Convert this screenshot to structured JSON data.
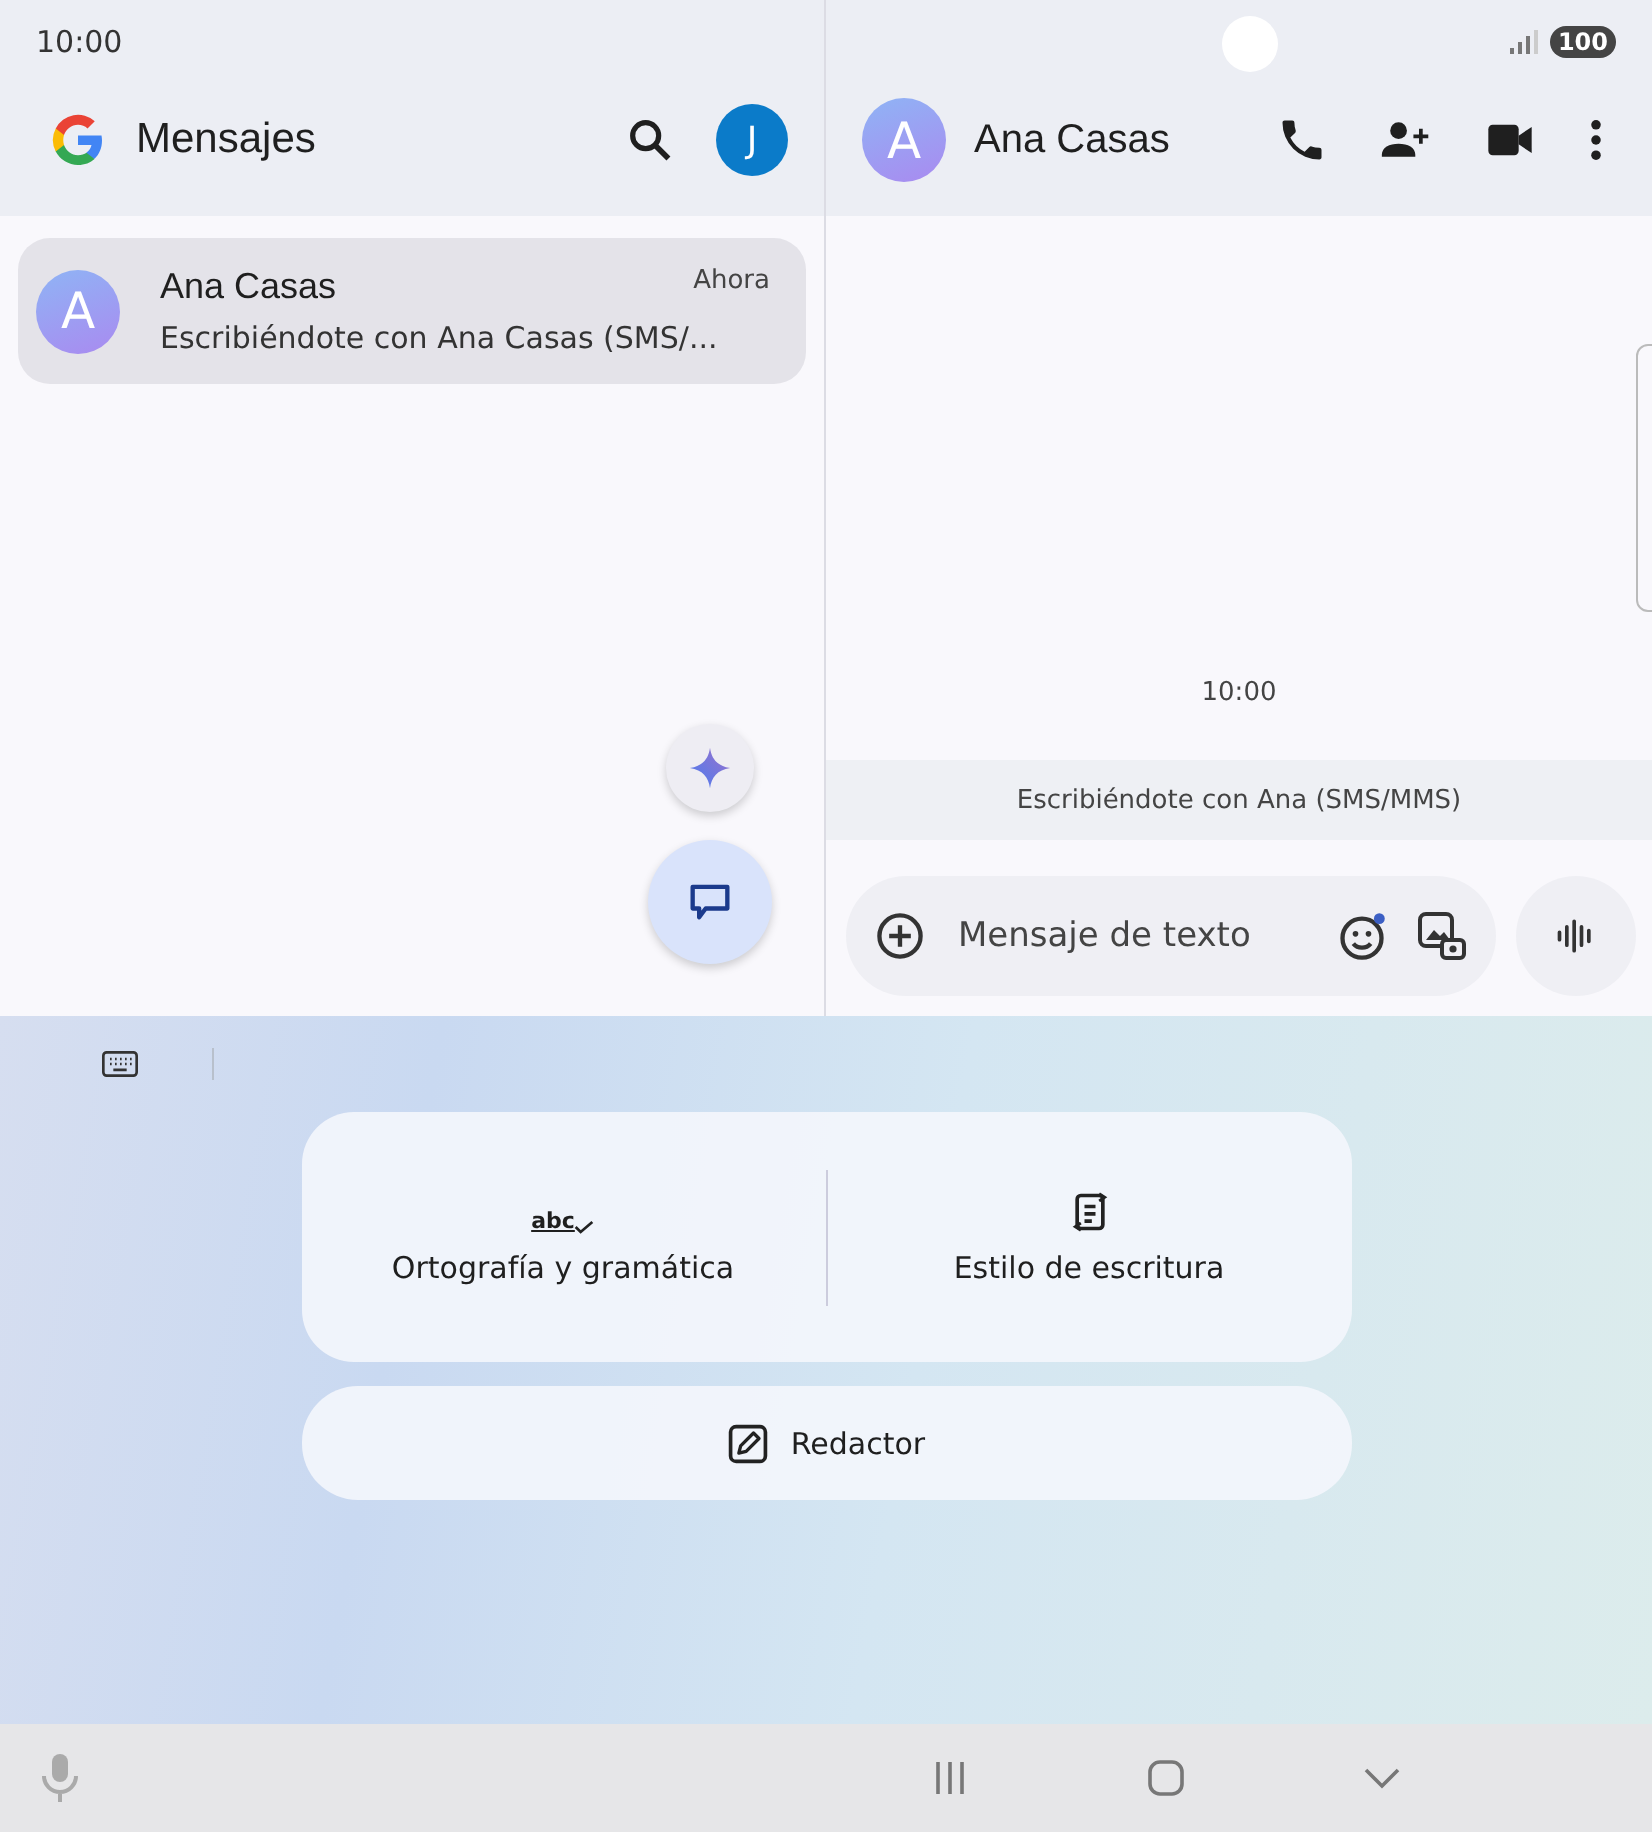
{
  "status_bar": {
    "time": "10:00",
    "battery": "100"
  },
  "list_pane": {
    "title": "Mensajes",
    "account_initial": "J",
    "conversations": [
      {
        "initial": "A",
        "name": "Ana Casas",
        "time": "Ahora",
        "snippet": "Escribiéndote con Ana Casas (SMS/...",
        "selected": true
      }
    ]
  },
  "chat_pane": {
    "contact_initial": "A",
    "contact_name": "Ana Casas",
    "timestamp": "10:00",
    "banner": "Escribiéndote con Ana (SMS/MMS)",
    "composer": {
      "placeholder": "Mensaje de texto"
    }
  },
  "writing_tools": {
    "options": [
      {
        "kind": "spelling",
        "icon_text": "abc",
        "label": "Ortografía y gramática"
      },
      {
        "kind": "style",
        "label": "Estilo de escritura"
      }
    ],
    "compose": {
      "label": "Redactor"
    }
  }
}
